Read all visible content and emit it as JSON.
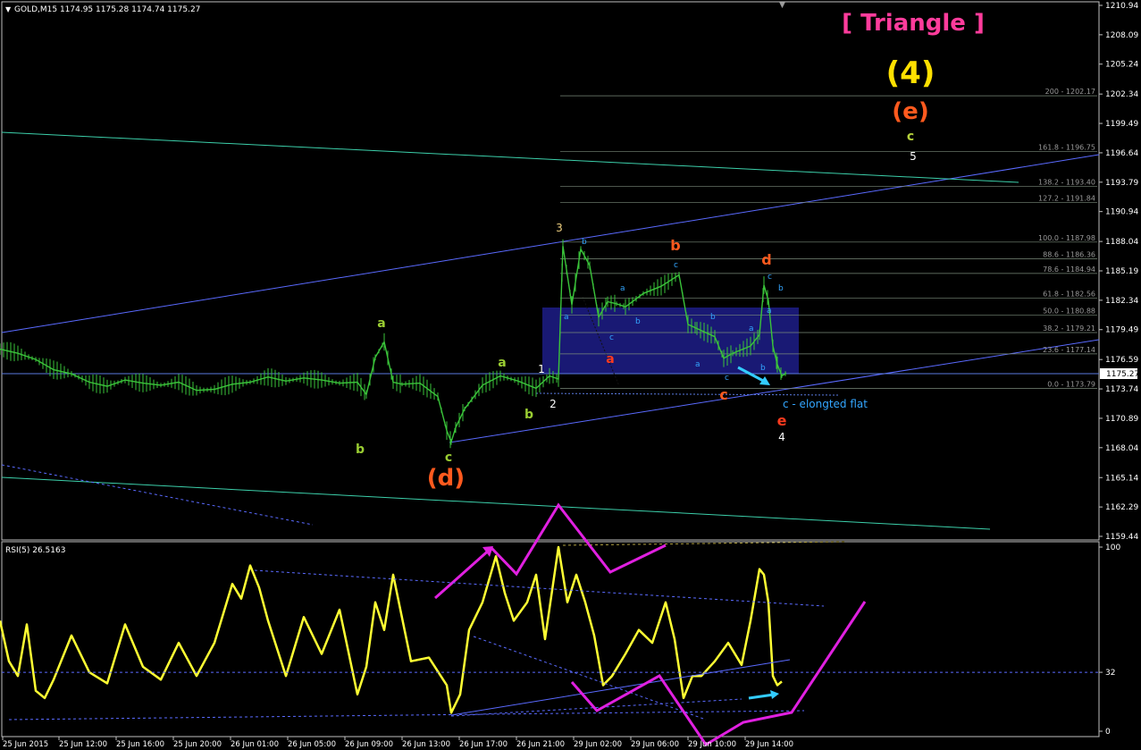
{
  "chart_data": [
    {
      "type": "line",
      "title": "GOLD,M15  1174.95 1175.28 1174.74 1175.27",
      "note_title": "[ Triangle ]",
      "current_price": "1175.27",
      "ylim": [
        1159.0,
        1211.0
      ],
      "y_ticks": [
        "1210.94",
        "1208.09",
        "1205.24",
        "1202.34",
        "1199.49",
        "1196.64",
        "1193.79",
        "1190.94",
        "1188.04",
        "1185.19",
        "1182.34",
        "1179.49",
        "1176.59",
        "1173.74",
        "1170.89",
        "1168.04",
        "1165.14",
        "1162.29",
        "1159.44"
      ],
      "x_ticks": [
        "25 Jun 2015",
        "25 Jun 12:00",
        "25 Jun 16:00",
        "25 Jun 20:00",
        "26 Jun 01:00",
        "26 Jun 05:00",
        "26 Jun 09:00",
        "26 Jun 13:00",
        "26 Jun 17:00",
        "26 Jun 21:00",
        "29 Jun 02:00",
        "29 Jun 06:00",
        "29 Jun 10:00",
        "29 Jun 14:00"
      ],
      "fib_levels": [
        {
          "label": "200 - 1202.17",
          "value": 1202.17
        },
        {
          "label": "161.8 - 1196.75",
          "value": 1196.75
        },
        {
          "label": "138.2 - 1193.40",
          "value": 1193.4
        },
        {
          "label": "127.2 - 1191.84",
          "value": 1191.84
        },
        {
          "label": "100.0 - 1187.98",
          "value": 1187.98
        },
        {
          "label": "88.6 - 1186.36",
          "value": 1186.36
        },
        {
          "label": "78.6 - 1184.94",
          "value": 1184.94
        },
        {
          "label": "61.8 - 1182.56",
          "value": 1182.56
        },
        {
          "label": "50.0 - 1180.88",
          "value": 1180.88
        },
        {
          "label": "38.2 - 1179.21",
          "value": 1179.21
        },
        {
          "label": "23.6 - 1177.14",
          "value": 1177.14
        },
        {
          "label": "0.0 - 1173.79",
          "value": 1173.79
        }
      ],
      "price_series": {
        "x": [
          0,
          20,
          40,
          60,
          80,
          100,
          120,
          140,
          160,
          180,
          200,
          220,
          240,
          260,
          280,
          300,
          320,
          340,
          360,
          380,
          400,
          410,
          420,
          430,
          440,
          450,
          470,
          490,
          500,
          505,
          510,
          520,
          540,
          560,
          580,
          600,
          615,
          625,
          630,
          640,
          650,
          660,
          670,
          680,
          690,
          700,
          720,
          740,
          760,
          770,
          780,
          800,
          810,
          820,
          840,
          850,
          855,
          860,
          865,
          870,
          875,
          880
        ],
        "y": [
          1177.6,
          1177.2,
          1176.6,
          1175.6,
          1175.2,
          1174.4,
          1174.0,
          1174.6,
          1174.3,
          1174.1,
          1174.4,
          1173.6,
          1173.7,
          1174.2,
          1174.4,
          1174.9,
          1174.5,
          1174.8,
          1174.6,
          1174.3,
          1174.4,
          1173.2,
          1176.8,
          1178.3,
          1174.4,
          1174.2,
          1174.3,
          1173.0,
          1169.7,
          1168.6,
          1170.0,
          1171.8,
          1174.1,
          1175.0,
          1174.5,
          1173.8,
          1175.0,
          1174.7,
          1187.6,
          1181.9,
          1187.3,
          1185.7,
          1180.7,
          1182.2,
          1182.0,
          1181.7,
          1183.0,
          1183.7,
          1184.8,
          1180.0,
          1179.6,
          1178.8,
          1176.7,
          1177.2,
          1177.9,
          1179.0,
          1183.8,
          1182.3,
          1177.9,
          1176.1,
          1175.0,
          1175.27
        ]
      },
      "wave_labels": [
        {
          "text": "[ Triangle ]",
          "color": "#ff3c9c"
        },
        {
          "text": "(4)",
          "color": "#ffe000"
        },
        {
          "text": "(e)",
          "color": "#ff5a1e"
        },
        {
          "text": "(d)",
          "color": "#ff5a1e"
        },
        {
          "text": "c",
          "color": "#b6d23c"
        },
        {
          "text": "5",
          "color": "#ffffff"
        },
        {
          "text": "3",
          "color": "#f0d080"
        },
        {
          "text": "1",
          "color": "#ffffff"
        },
        {
          "text": "2",
          "color": "#ffffff"
        },
        {
          "text": "4",
          "color": "#ffffff"
        },
        {
          "text": "a",
          "color": "#9acd32"
        },
        {
          "text": "b",
          "color": "#9acd32"
        },
        {
          "text": "a",
          "color": "#9acd32"
        },
        {
          "text": "b",
          "color": "#9acd32"
        },
        {
          "text": "c",
          "color": "#9acd32"
        },
        {
          "text": "a",
          "color": "#ff3a1e"
        },
        {
          "text": "b",
          "color": "#ff5a1e"
        },
        {
          "text": "c",
          "color": "#ff5a1e"
        },
        {
          "text": "d",
          "color": "#ff5a1e"
        },
        {
          "text": "e",
          "color": "#ff3a1e"
        },
        {
          "text": "c - elongted flat",
          "color": "#33a6ff"
        }
      ]
    },
    {
      "type": "line",
      "title": "RSI(5) 26.5163",
      "ylim": [
        0,
        100
      ],
      "y_ticks": [
        "100",
        "32",
        "0"
      ],
      "level": 32,
      "rsi_series": {
        "x": [
          0,
          10,
          20,
          30,
          40,
          50,
          60,
          80,
          100,
          120,
          140,
          160,
          180,
          200,
          220,
          240,
          260,
          270,
          280,
          290,
          300,
          320,
          340,
          360,
          380,
          400,
          410,
          420,
          430,
          440,
          460,
          480,
          500,
          505,
          515,
          525,
          540,
          555,
          565,
          575,
          590,
          600,
          610,
          625,
          635,
          645,
          655,
          665,
          675,
          685,
          700,
          715,
          730,
          745,
          755,
          765,
          775,
          785,
          800,
          815,
          830,
          840,
          850,
          855,
          860,
          865,
          870,
          875
        ],
        "y": [
          60,
          38,
          30,
          58,
          22,
          18,
          28,
          52,
          32,
          26,
          58,
          35,
          28,
          48,
          30,
          48,
          80,
          72,
          90,
          78,
          60,
          30,
          62,
          42,
          66,
          20,
          35,
          70,
          55,
          85,
          38,
          40,
          25,
          10,
          20,
          55,
          70,
          95,
          75,
          60,
          70,
          85,
          50,
          100,
          70,
          85,
          70,
          52,
          25,
          30,
          42,
          55,
          48,
          70,
          50,
          18,
          30,
          30,
          38,
          48,
          36,
          60,
          88,
          85,
          70,
          30,
          25,
          27
        ]
      }
    }
  ]
}
